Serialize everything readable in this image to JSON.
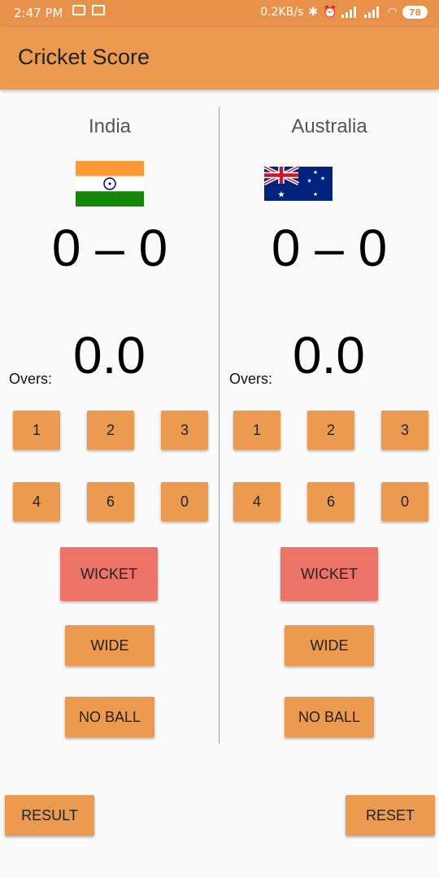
{
  "status_bar": {
    "time": "2:47 PM",
    "speed": "0.2KB/s",
    "battery": "78",
    "icons": [
      "mail-icon",
      "laptop-icon",
      "bluetooth-icon",
      "alarm-off-icon",
      "volte-icon",
      "signal-icon",
      "volte-icon",
      "signal-icon",
      "wifi-icon",
      "battery-icon"
    ]
  },
  "app": {
    "title": "Cricket Score",
    "accent": "#ec9a4f",
    "wicket_color": "#eb7367"
  },
  "teams": [
    {
      "name": "India",
      "flag": "india-flag",
      "score": "0 – 0",
      "overs_label": "Overs:",
      "overs_value": "0.0",
      "runs": [
        "1",
        "2",
        "3",
        "4",
        "6",
        "0"
      ],
      "wicket": "WICKET",
      "wide": "WIDE",
      "no_ball": "NO BALL"
    },
    {
      "name": "Australia",
      "flag": "australia-flag",
      "score": "0 – 0",
      "overs_label": "Overs:",
      "overs_value": "0.0",
      "runs": [
        "1",
        "2",
        "3",
        "4",
        "6",
        "0"
      ],
      "wicket": "WICKET",
      "wide": "WIDE",
      "no_ball": "NO BALL"
    }
  ],
  "footer": {
    "result": "RESULT",
    "reset": "RESET"
  }
}
